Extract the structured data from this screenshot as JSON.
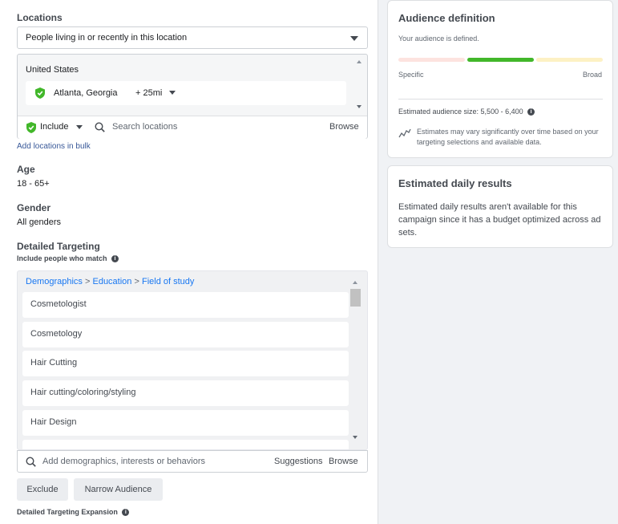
{
  "locations": {
    "label": "Locations",
    "type_value": "People living in or recently in this location",
    "country": "United States",
    "city": "Atlanta, Georgia",
    "radius": "+ 25mi",
    "include_label": "Include",
    "search_placeholder": "Search locations",
    "browse_label": "Browse",
    "bulk_link": "Add locations in bulk"
  },
  "age": {
    "label": "Age",
    "value": "18 - 65+"
  },
  "gender": {
    "label": "Gender",
    "value": "All genders"
  },
  "detailed_targeting": {
    "label": "Detailed Targeting",
    "sub_label": "Include people who match",
    "breadcrumb": [
      "Demographics",
      "Education",
      "Field of study"
    ],
    "separator": ">",
    "items": [
      "Cosmetologist",
      "Cosmetology",
      "Hair Cutting",
      "Hair cutting/coloring/styling",
      "Hair Design"
    ],
    "search_placeholder": "Add demographics, interests or behaviors",
    "suggestions_label": "Suggestions",
    "browse_label": "Browse",
    "exclude_button": "Exclude",
    "narrow_button": "Narrow Audience",
    "expansion_label": "Detailed Targeting Expansion"
  },
  "audience_definition": {
    "title": "Audience definition",
    "status": "Your audience is defined.",
    "specific_label": "Specific",
    "broad_label": "Broad",
    "estimated_size": "Estimated audience size: 5,500 - 6,400",
    "note": "Estimates may vary significantly over time based on your targeting selections and available data.",
    "colors": {
      "left": "#fde3df",
      "middle": "#42b72a",
      "right": "#fdf1c4"
    }
  },
  "daily_results": {
    "title": "Estimated daily results",
    "text": "Estimated daily results aren't available for this campaign since it has a budget optimized across ad sets."
  }
}
